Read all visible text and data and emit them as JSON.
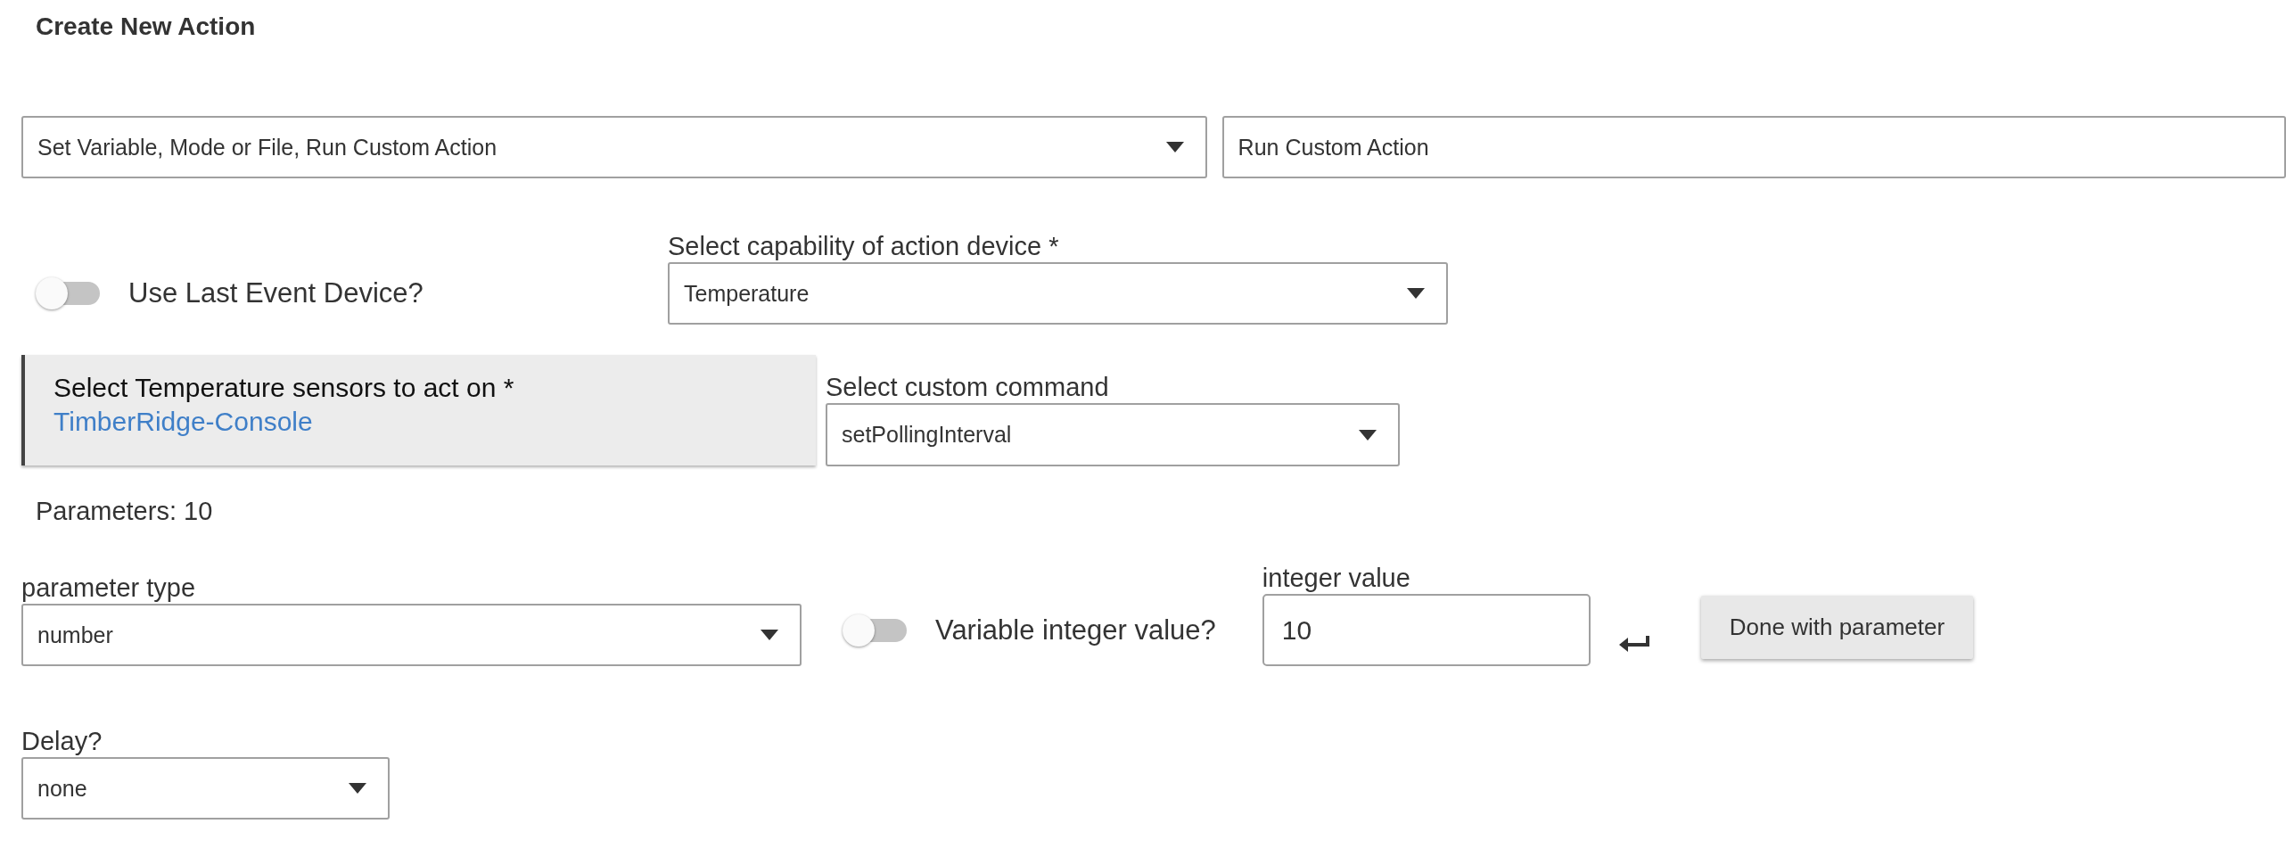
{
  "title": "Create New Action",
  "action_type": {
    "value": "Set Variable, Mode or File, Run Custom Action"
  },
  "action": {
    "value": "Run Custom Action"
  },
  "use_last_event_device": {
    "label": "Use Last Event Device?",
    "on": false
  },
  "capability": {
    "label": "Select capability of action device *",
    "value": "Temperature"
  },
  "device_picker": {
    "label": "Select Temperature sensors to act on *",
    "selected_device": "TimberRidge-Console"
  },
  "custom_command": {
    "label": "Select custom command",
    "value": "setPollingInterval"
  },
  "parameters_label": "Parameters: 10",
  "parameter_type": {
    "label": "parameter type",
    "value": "number"
  },
  "variable_integer": {
    "label": "Variable integer value?",
    "on": false
  },
  "integer_value": {
    "label": "integer value",
    "value": "10"
  },
  "done_button": "Done with parameter",
  "delay": {
    "label": "Delay?",
    "value": "none"
  }
}
